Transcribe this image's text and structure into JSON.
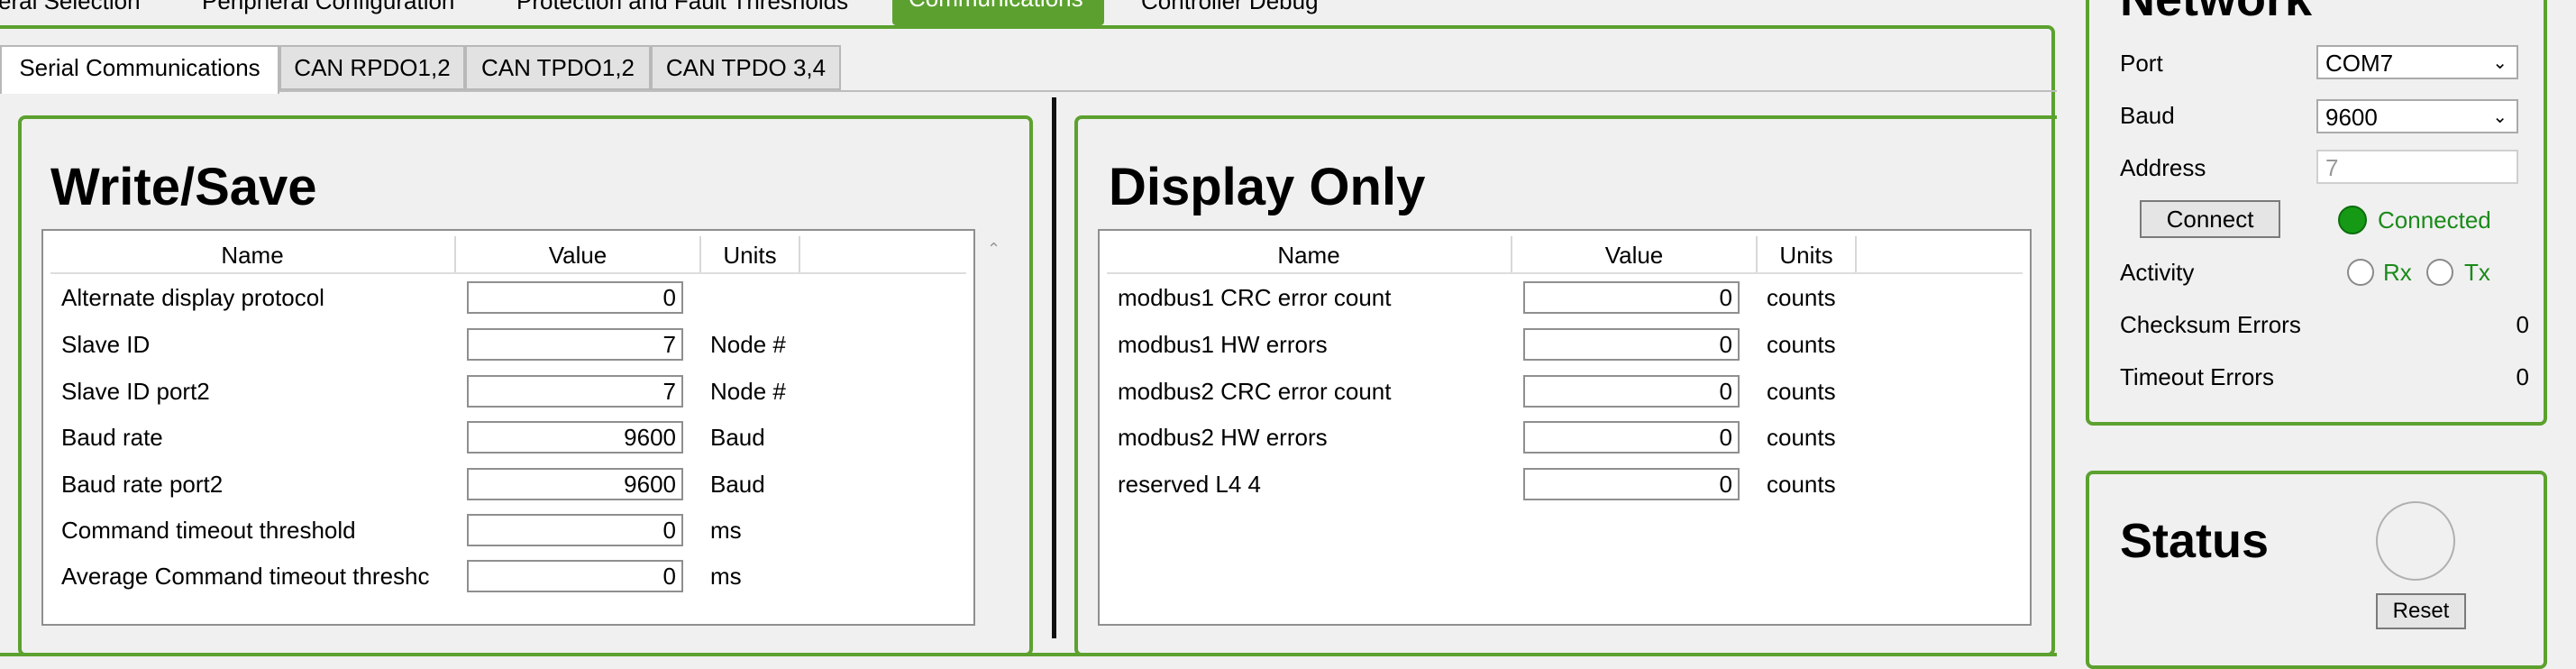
{
  "top_tabs": [
    {
      "label": "eral Selection"
    },
    {
      "label": "Peripheral Configuration"
    },
    {
      "label": "Protection and Fault Thresholds"
    },
    {
      "label": "Communications"
    },
    {
      "label": "Controller Debug"
    }
  ],
  "sub_tabs": [
    {
      "label": "Serial Communications"
    },
    {
      "label": "CAN RPDO1,2"
    },
    {
      "label": "CAN TPDO1,2"
    },
    {
      "label": "CAN TPDO 3,4"
    }
  ],
  "write_save": {
    "title": "Write/Save",
    "columns": {
      "name": "Name",
      "value": "Value",
      "units": "Units"
    },
    "rows": [
      {
        "name": "Alternate display protocol",
        "value": "0",
        "units": ""
      },
      {
        "name": "Slave ID",
        "value": "7",
        "units": "Node #"
      },
      {
        "name": "Slave ID port2",
        "value": "7",
        "units": "Node #"
      },
      {
        "name": "Baud rate",
        "value": "9600",
        "units": "Baud"
      },
      {
        "name": "Baud rate port2",
        "value": "9600",
        "units": "Baud"
      },
      {
        "name": "Command timeout threshold",
        "value": "0",
        "units": "ms"
      },
      {
        "name": "Average Command timeout threshc",
        "value": "0",
        "units": "ms"
      }
    ]
  },
  "display_only": {
    "title": "Display Only",
    "columns": {
      "name": "Name",
      "value": "Value",
      "units": "Units"
    },
    "rows": [
      {
        "name": "modbus1 CRC error count",
        "value": "0",
        "units": "counts"
      },
      {
        "name": "modbus1 HW errors",
        "value": "0",
        "units": "counts"
      },
      {
        "name": "modbus2 CRC error count",
        "value": "0",
        "units": "counts"
      },
      {
        "name": "modbus2 HW errors",
        "value": "0",
        "units": "counts"
      },
      {
        "name": "reserved L4 4",
        "value": "0",
        "units": "counts"
      }
    ]
  },
  "network": {
    "title": "Network",
    "port_label": "Port",
    "port_value": "COM7",
    "baud_label": "Baud",
    "baud_value": "9600",
    "address_label": "Address",
    "address_value": "7",
    "connect_label": "Connect",
    "status_text": "Connected",
    "activity_label": "Activity",
    "rx_label": "Rx",
    "tx_label": "Tx",
    "checksum_label": "Checksum Errors",
    "checksum_value": "0",
    "timeout_label": "Timeout Errors",
    "timeout_value": "0",
    "dropdown_icon": "chevron-down-icon"
  },
  "status": {
    "title": "Status",
    "reset_label": "Reset"
  },
  "colors": {
    "accent": "#5ca12f",
    "connected": "#1a8a1a"
  }
}
